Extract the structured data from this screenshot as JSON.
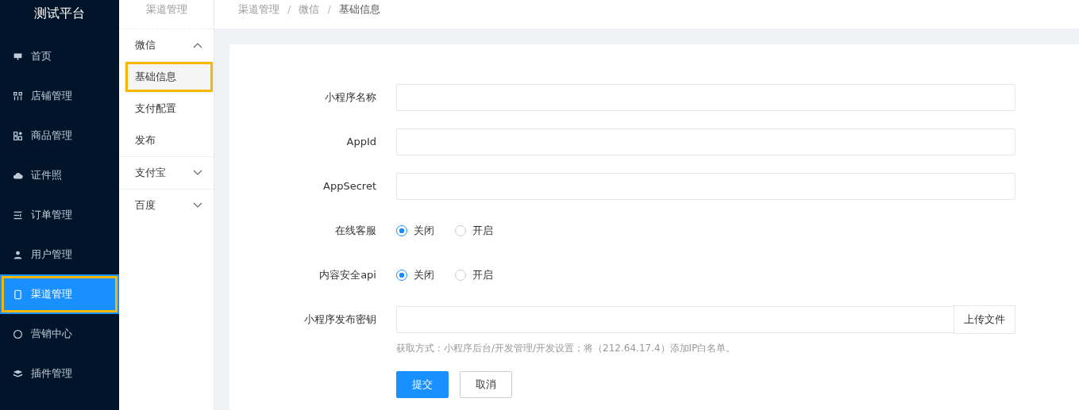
{
  "app_title": "测试平台",
  "sidebar": {
    "items": [
      {
        "label": "首页",
        "selected": false
      },
      {
        "label": "店铺管理",
        "selected": false
      },
      {
        "label": "商品管理",
        "selected": false
      },
      {
        "label": "证件照",
        "selected": false
      },
      {
        "label": "订单管理",
        "selected": false
      },
      {
        "label": "用户管理",
        "selected": false
      },
      {
        "label": "渠道管理",
        "selected": true
      },
      {
        "label": "营销中心",
        "selected": false
      },
      {
        "label": "插件管理",
        "selected": false
      }
    ]
  },
  "submenu": {
    "title": "渠道管理",
    "groups": [
      {
        "label": "微信",
        "expanded": true,
        "items": [
          {
            "label": "基础信息",
            "selected": true
          },
          {
            "label": "支付配置",
            "selected": false
          },
          {
            "label": "发布",
            "selected": false
          }
        ]
      },
      {
        "label": "支付宝",
        "expanded": false
      },
      {
        "label": "百度",
        "expanded": false
      }
    ]
  },
  "breadcrumb": {
    "separator": "/",
    "items": [
      "渠道管理",
      "微信",
      "基础信息"
    ]
  },
  "form": {
    "fields": [
      {
        "kind": "text",
        "label": "小程序名称"
      },
      {
        "kind": "text",
        "label": "AppId"
      },
      {
        "kind": "text",
        "label": "AppSecret"
      },
      {
        "kind": "radio",
        "label": "在线客服",
        "options": [
          {
            "label": "关闭",
            "selected": true
          },
          {
            "label": "开启",
            "selected": false
          }
        ]
      },
      {
        "kind": "radio",
        "label": "内容安全api",
        "options": [
          {
            "label": "关闭",
            "selected": true
          },
          {
            "label": "开启",
            "selected": false
          }
        ]
      },
      {
        "kind": "file",
        "label": "小程序发布密钥",
        "button": "上传文件",
        "hint": "获取方式：小程序后台/开发管理/开发设置；将（212.64.17.4）添加IP白名单。"
      }
    ],
    "submit": "提交",
    "cancel": "取消"
  }
}
